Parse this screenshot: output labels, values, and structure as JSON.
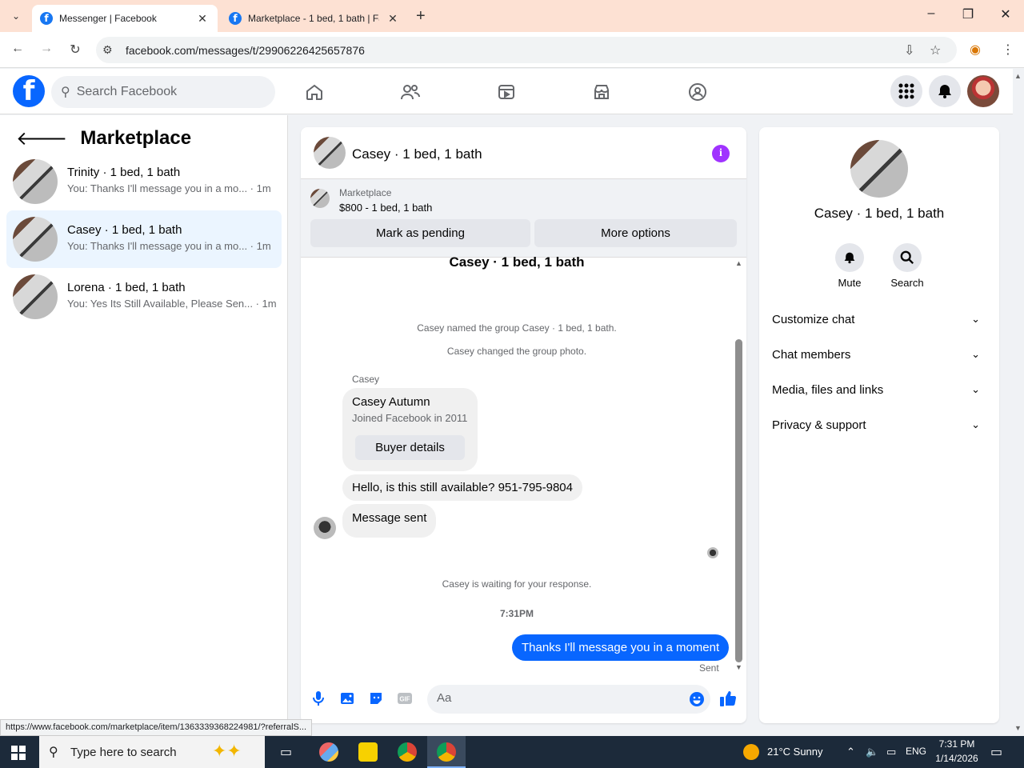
{
  "browser": {
    "tabs": [
      {
        "title": "Messenger | Facebook",
        "active": true
      },
      {
        "title": "Marketplace - 1 bed, 1 bath | Fa",
        "active": false
      }
    ],
    "url": "facebook.com/messages/t/29906226425657876",
    "status_url": "https://www.facebook.com/marketplace/item/1363339368224981/?referralS..."
  },
  "fbnav": {
    "logo": "f",
    "search_placeholder": "Search Facebook"
  },
  "left": {
    "title": "Marketplace",
    "conversations": [
      {
        "name": "Trinity · 1 bed, 1 bath",
        "preview": "You: Thanks I'll message you in a mo... · 1m",
        "selected": false
      },
      {
        "name": "Casey · 1 bed, 1 bath",
        "preview": "You: Thanks I'll message you in a mo... · 1m",
        "selected": true
      },
      {
        "name": "Lorena · 1 bed, 1 bath",
        "preview": "You: Yes Its Still Available, Please Sen... · 1m",
        "selected": false
      }
    ]
  },
  "chat": {
    "header_name": "Casey · 1 bed, 1 bath",
    "info_icon": "i",
    "marketplace_label": "Marketplace",
    "listing": "$800 - 1 bed, 1 bath",
    "mark_pending": "Mark as pending",
    "more_options": "More options",
    "thread_title": "Casey · 1 bed, 1 bath",
    "sys1": "Casey named the group Casey · 1 bed, 1 bath.",
    "sys2": "Casey changed the group photo.",
    "sender": "Casey",
    "card_name": "Casey Autumn",
    "card_sub": "Joined Facebook in 2011",
    "buyer_details": "Buyer details",
    "msg1": "Hello, is this still available? 951-795-9804",
    "msg2": "Message sent",
    "waiting": "Casey is waiting for your response.",
    "time": "7:31PM",
    "out_msg": "Thanks I'll message you in a moment",
    "sent": "Sent",
    "composer_placeholder": "Aa"
  },
  "info": {
    "name": "Casey · 1 bed, 1 bath",
    "actions": [
      {
        "label": "Mute"
      },
      {
        "label": "Search"
      }
    ],
    "sections": [
      "Customize chat",
      "Chat members",
      "Media, files and links",
      "Privacy & support"
    ]
  },
  "taskbar": {
    "search_placeholder": "Type here to search",
    "weather": "21°C  Sunny",
    "lang": "ENG",
    "time": "7:31 PM",
    "date": "1/14/2026"
  },
  "colors": {
    "fb_blue": "#0866ff",
    "info_purple": "#a033ff",
    "selected_row": "#ebf5ff"
  }
}
